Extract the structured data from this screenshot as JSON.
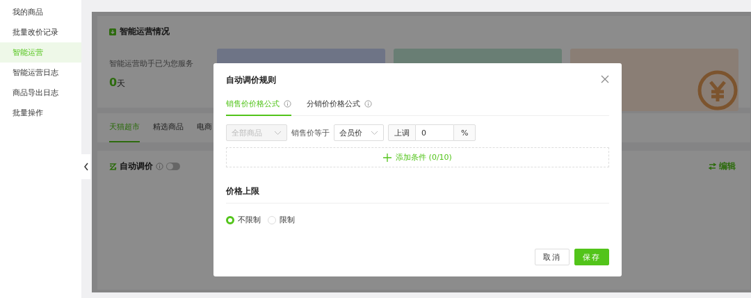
{
  "sidebar": {
    "items": [
      {
        "label": "我的商品",
        "selected": false
      },
      {
        "label": "批量改价记录",
        "selected": false
      },
      {
        "label": "智能运营",
        "selected": true
      },
      {
        "label": "智能运营日志",
        "selected": false
      },
      {
        "label": "商品导出日志",
        "selected": false
      },
      {
        "label": "批量操作",
        "selected": false
      }
    ]
  },
  "overview": {
    "title": "智能运营情况",
    "service_label": "智能运营助手已为您服务",
    "days_value": "0",
    "days_unit": "天"
  },
  "tabs": [
    {
      "label": "天猫超市",
      "selected": true
    },
    {
      "label": "精选商品",
      "selected": false
    },
    {
      "label": "电商",
      "selected": false
    }
  ],
  "auto_pricing": {
    "title": "自动调价",
    "enabled": false,
    "edit_label": "编辑"
  },
  "dialog": {
    "title": "自动调价规则",
    "tabs": [
      {
        "label": "销售价价格公式",
        "selected": true
      },
      {
        "label": "分销价价格公式",
        "selected": false
      }
    ],
    "rule": {
      "scope": {
        "value": "全部商品",
        "disabled": true
      },
      "equals_label": "销售价等于",
      "base": {
        "value": "会员价",
        "disabled": false
      },
      "adjust_label": "上调",
      "adjust_value": "0",
      "unit": "%"
    },
    "add_condition": "添加条件 (0/10)",
    "limit": {
      "title": "价格上限",
      "options": [
        {
          "label": "不限制",
          "selected": true
        },
        {
          "label": "限制",
          "selected": false
        }
      ]
    },
    "buttons": [
      {
        "label": "取消",
        "kind": "default"
      },
      {
        "label": "保存",
        "kind": "primary"
      }
    ]
  }
}
